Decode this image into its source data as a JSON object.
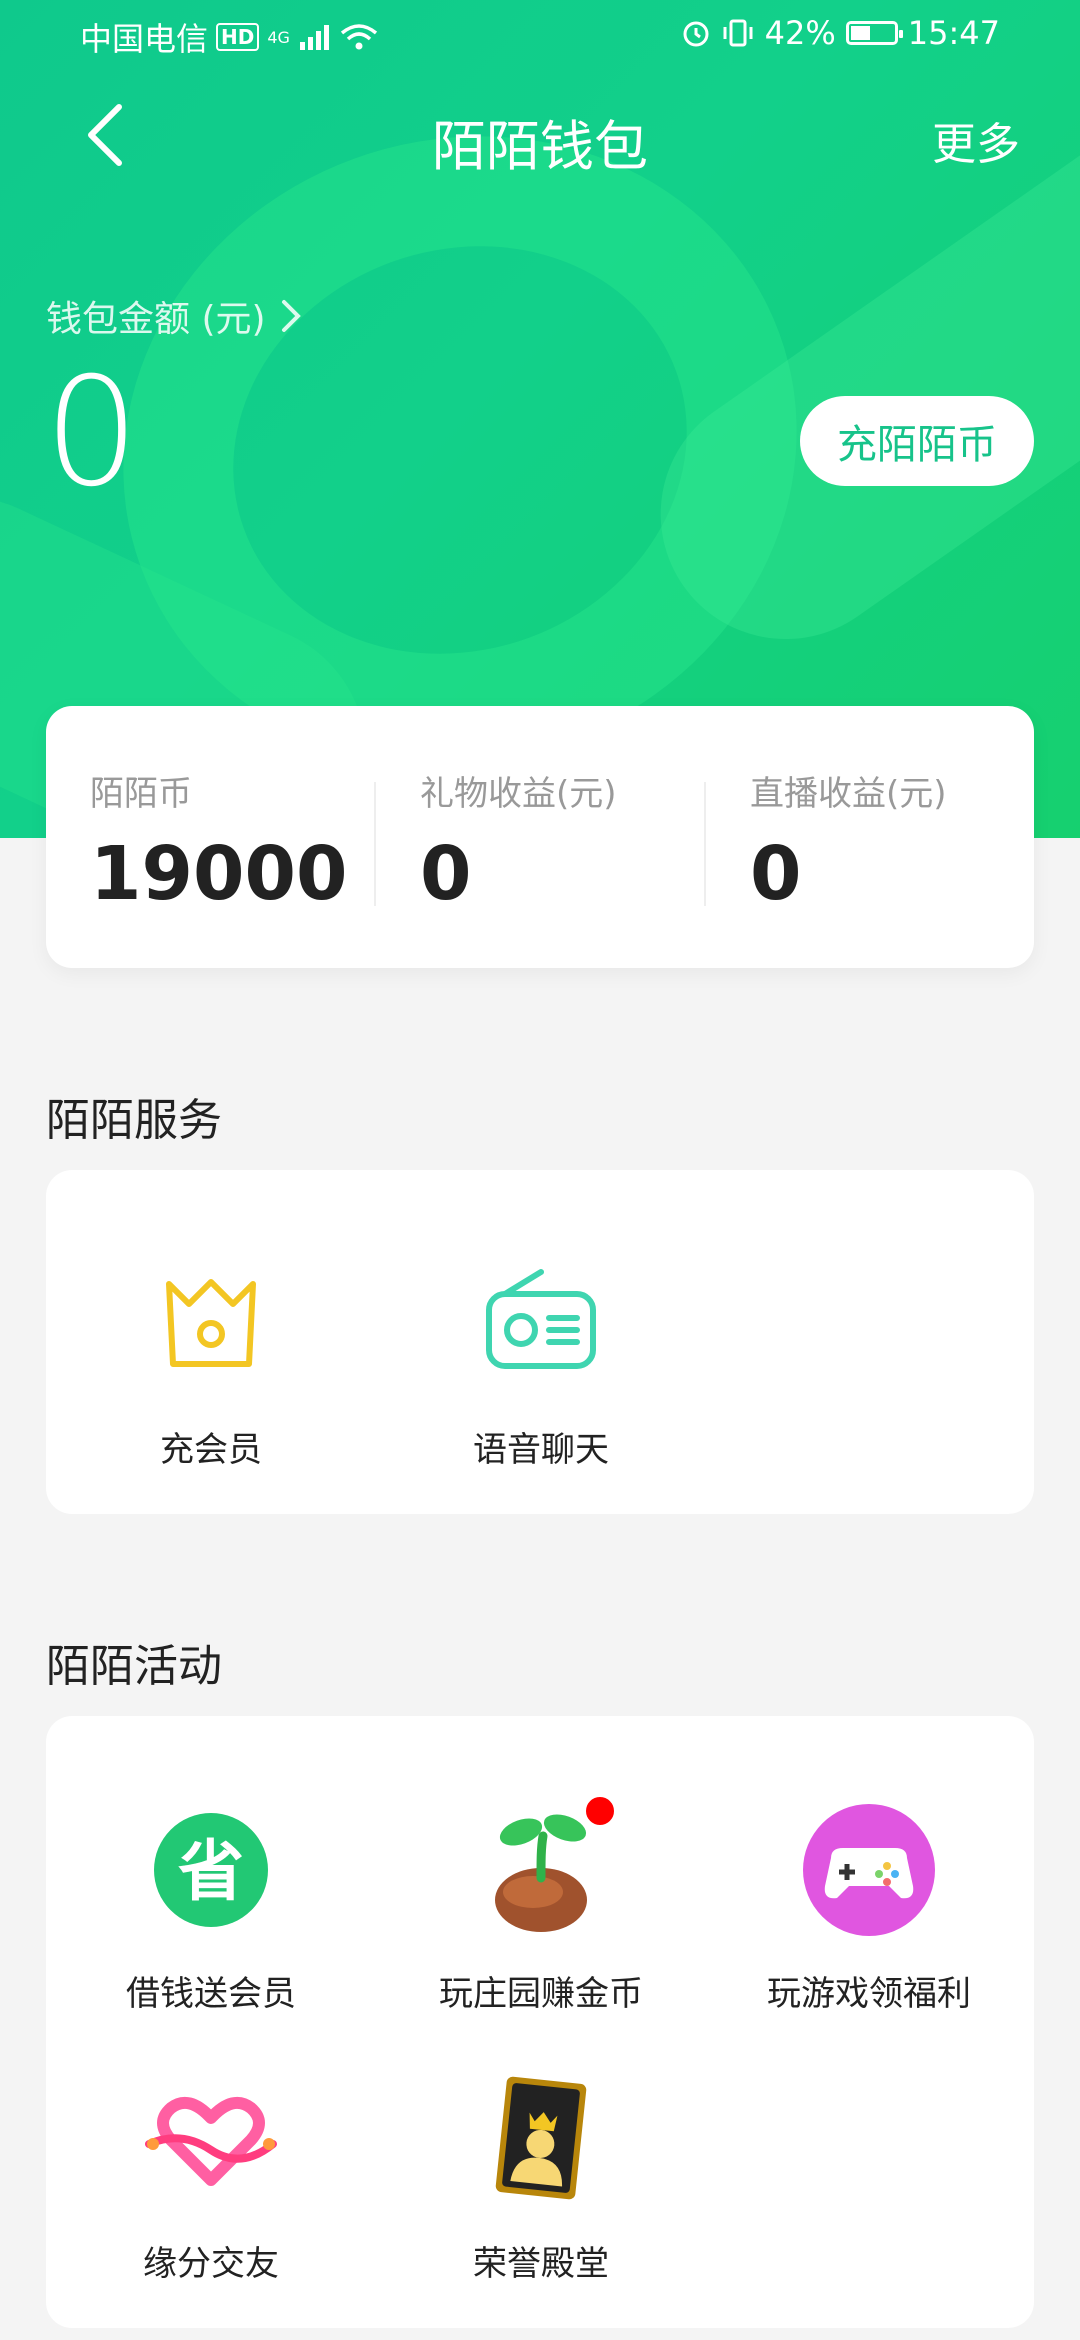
{
  "status": {
    "carrier": "中国电信",
    "hd": "HD",
    "net": "4G",
    "battery": "42%",
    "battery_level": 0.42,
    "time": "15:47"
  },
  "nav": {
    "title": "陌陌钱包",
    "more": "更多"
  },
  "wallet": {
    "label": "钱包金额 (元)",
    "amount": "0",
    "recharge": "充陌陌币"
  },
  "stats": [
    {
      "label": "陌陌币",
      "value": "19000"
    },
    {
      "label": "礼物收益(元)",
      "value": "0"
    },
    {
      "label": "直播收益(元)",
      "value": "0"
    }
  ],
  "services": {
    "title": "陌陌服务",
    "items": [
      {
        "label": "充会员",
        "icon": "crown-icon"
      },
      {
        "label": "语音聊天",
        "icon": "radio-icon"
      }
    ]
  },
  "activities": {
    "title": "陌陌活动",
    "items": [
      {
        "label": "借钱送会员",
        "icon": "save-coin-icon",
        "badge_text": "省"
      },
      {
        "label": "玩庄园赚金币",
        "icon": "sprout-icon"
      },
      {
        "label": "玩游戏领福利",
        "icon": "gamepad-icon"
      },
      {
        "label": "缘分交友",
        "icon": "heart-knot-icon"
      },
      {
        "label": "荣誉殿堂",
        "icon": "king-card-icon"
      }
    ]
  },
  "colors": {
    "accent": "#12c98a",
    "brand_green": "#16d06f",
    "crown": "#f3c623",
    "radio": "#3fd5b0",
    "game": "#e056e0"
  }
}
